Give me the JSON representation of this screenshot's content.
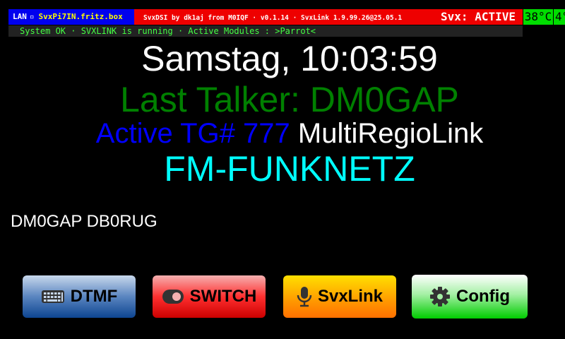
{
  "topbar": {
    "lan_label": "LAN",
    "lan_icon": "network-icon",
    "hostname": "SvxPi7IN.fritz.box",
    "version_text": "SvxDSI by dk1aj from M0IQF · v0.1.14 · SvxLink 1.9.99.26@25.05.1",
    "svx_status": "Svx: ACTIVE",
    "temperature": "38°C",
    "extra_value": "4°",
    "colors": {
      "lan_bg": "#0000ee",
      "hostname": "#ffff00",
      "version_bg": "#ee0000",
      "temp_bg": "#00dd00"
    }
  },
  "statusbar": {
    "text": "System OK · SVXLINK is running · Active Modules : >Parrot<",
    "color": "#44ff44"
  },
  "main": {
    "datetime": "Samstag, 10:03:59",
    "last_talker": "Last Talker: DM0GAP",
    "tg_prefix": "Active TG# 777",
    "tg_name": "MultiRegioLink",
    "network": "FM-FUNKNETZ",
    "callsigns": "DM0GAP DB0RUG",
    "colors": {
      "talker": "#008000",
      "tg_prefix": "#0000ff",
      "network": "#00ffff"
    }
  },
  "buttons": [
    {
      "label": "DTMF",
      "icon": "keyboard-icon"
    },
    {
      "label": "SWITCH",
      "icon": "toggle-icon"
    },
    {
      "label": "SvxLink",
      "icon": "microphone-icon"
    },
    {
      "label": "Config",
      "icon": "gear-icon"
    }
  ]
}
